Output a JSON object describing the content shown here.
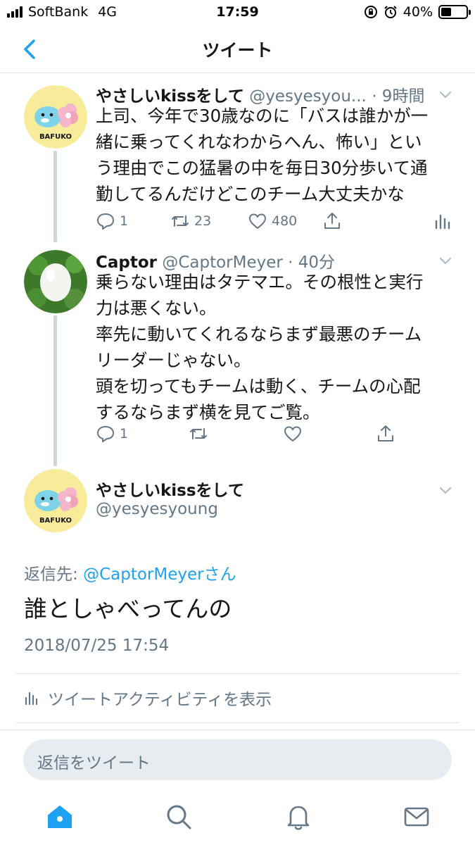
{
  "status_bar": {
    "carrier": "SoftBank",
    "network": "4G",
    "time": "17:59",
    "battery": "40%",
    "battery_level": 0.4
  },
  "nav": {
    "title": "ツイート"
  },
  "tweets": [
    {
      "name": "やさしいkissをして",
      "handle": "@yesyesyou...",
      "time": "· 9時間",
      "lines": [
        "上司、今年で30歳なのに「バスは誰かが一",
        "緒に乗ってくれなわからへん、怖い」とい",
        "う理由でこの猛暑の中を毎日30分歩いて通",
        "勤してるんだけどこのチーム大丈夫かな"
      ],
      "replies": "1",
      "retweets": "23",
      "likes": "480",
      "avatar_label": "BAFUKO"
    },
    {
      "name": "Captor",
      "handle": "@CaptorMeyer",
      "time": "· 40分",
      "lines": [
        "乗らない理由はタテマエ。その根性と実行",
        "力は悪くない。",
        "率先に動いてくれるならまず最悪のチーム",
        "リーダーじゃない。",
        "頭を切ってもチームは動く、チームの心配",
        "するならまず横を見てご覧。"
      ],
      "replies": "1"
    }
  ],
  "main_tweet": {
    "name": "やさしいkissをして",
    "handle": "@yesyesyoung",
    "avatar_label": "BAFUKO",
    "reply_to_prefix": "返信先: ",
    "reply_to_mention": "@CaptorMeyer",
    "reply_to_suffix": "さん",
    "text": "誰としゃべってんの",
    "timestamp": "2018/07/25 17:54",
    "activity_label": "ツイートアクティビティを表示"
  },
  "reply_bar": {
    "placeholder": "返信をツイート"
  },
  "tab_bar": {
    "items": [
      "home-icon",
      "search-icon",
      "notifications-icon",
      "messages-icon"
    ],
    "active": "home-icon"
  },
  "colors": {
    "accent": "#1da1f2",
    "secondary_text": "#657786",
    "divider": "#e1e8ed"
  }
}
